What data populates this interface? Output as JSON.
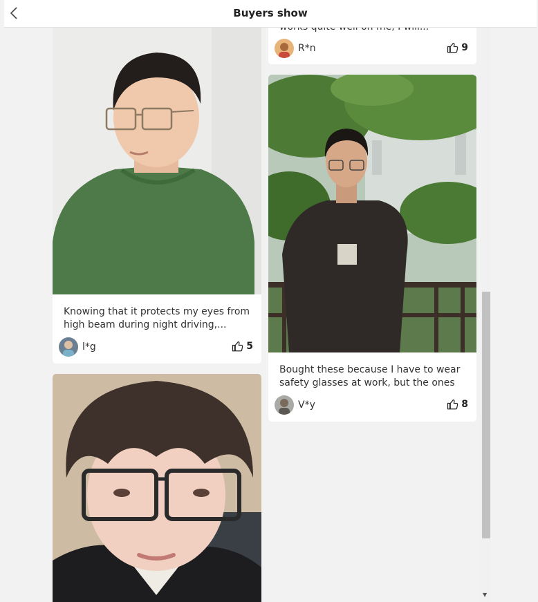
{
  "header": {
    "title": "Buyers show",
    "back_icon": "chevron-left-icon"
  },
  "posts": [
    {
      "caption": "Knowing that it protects my eyes from high beam during night driving,...",
      "user": "l*g",
      "likes": "5"
    },
    {
      "caption": "works quite well on me, I will...",
      "user": "R*n",
      "likes": "9"
    },
    {
      "caption": "Bought these because I have to wear safety glasses at work, but the ones w...",
      "user": "V*y",
      "likes": "8"
    },
    {
      "caption": "",
      "user": "",
      "likes": ""
    }
  ],
  "colors": {
    "background": "#f2f2f2",
    "card": "#ffffff",
    "shirt_green": "#4e7a49",
    "text": "#333333"
  }
}
